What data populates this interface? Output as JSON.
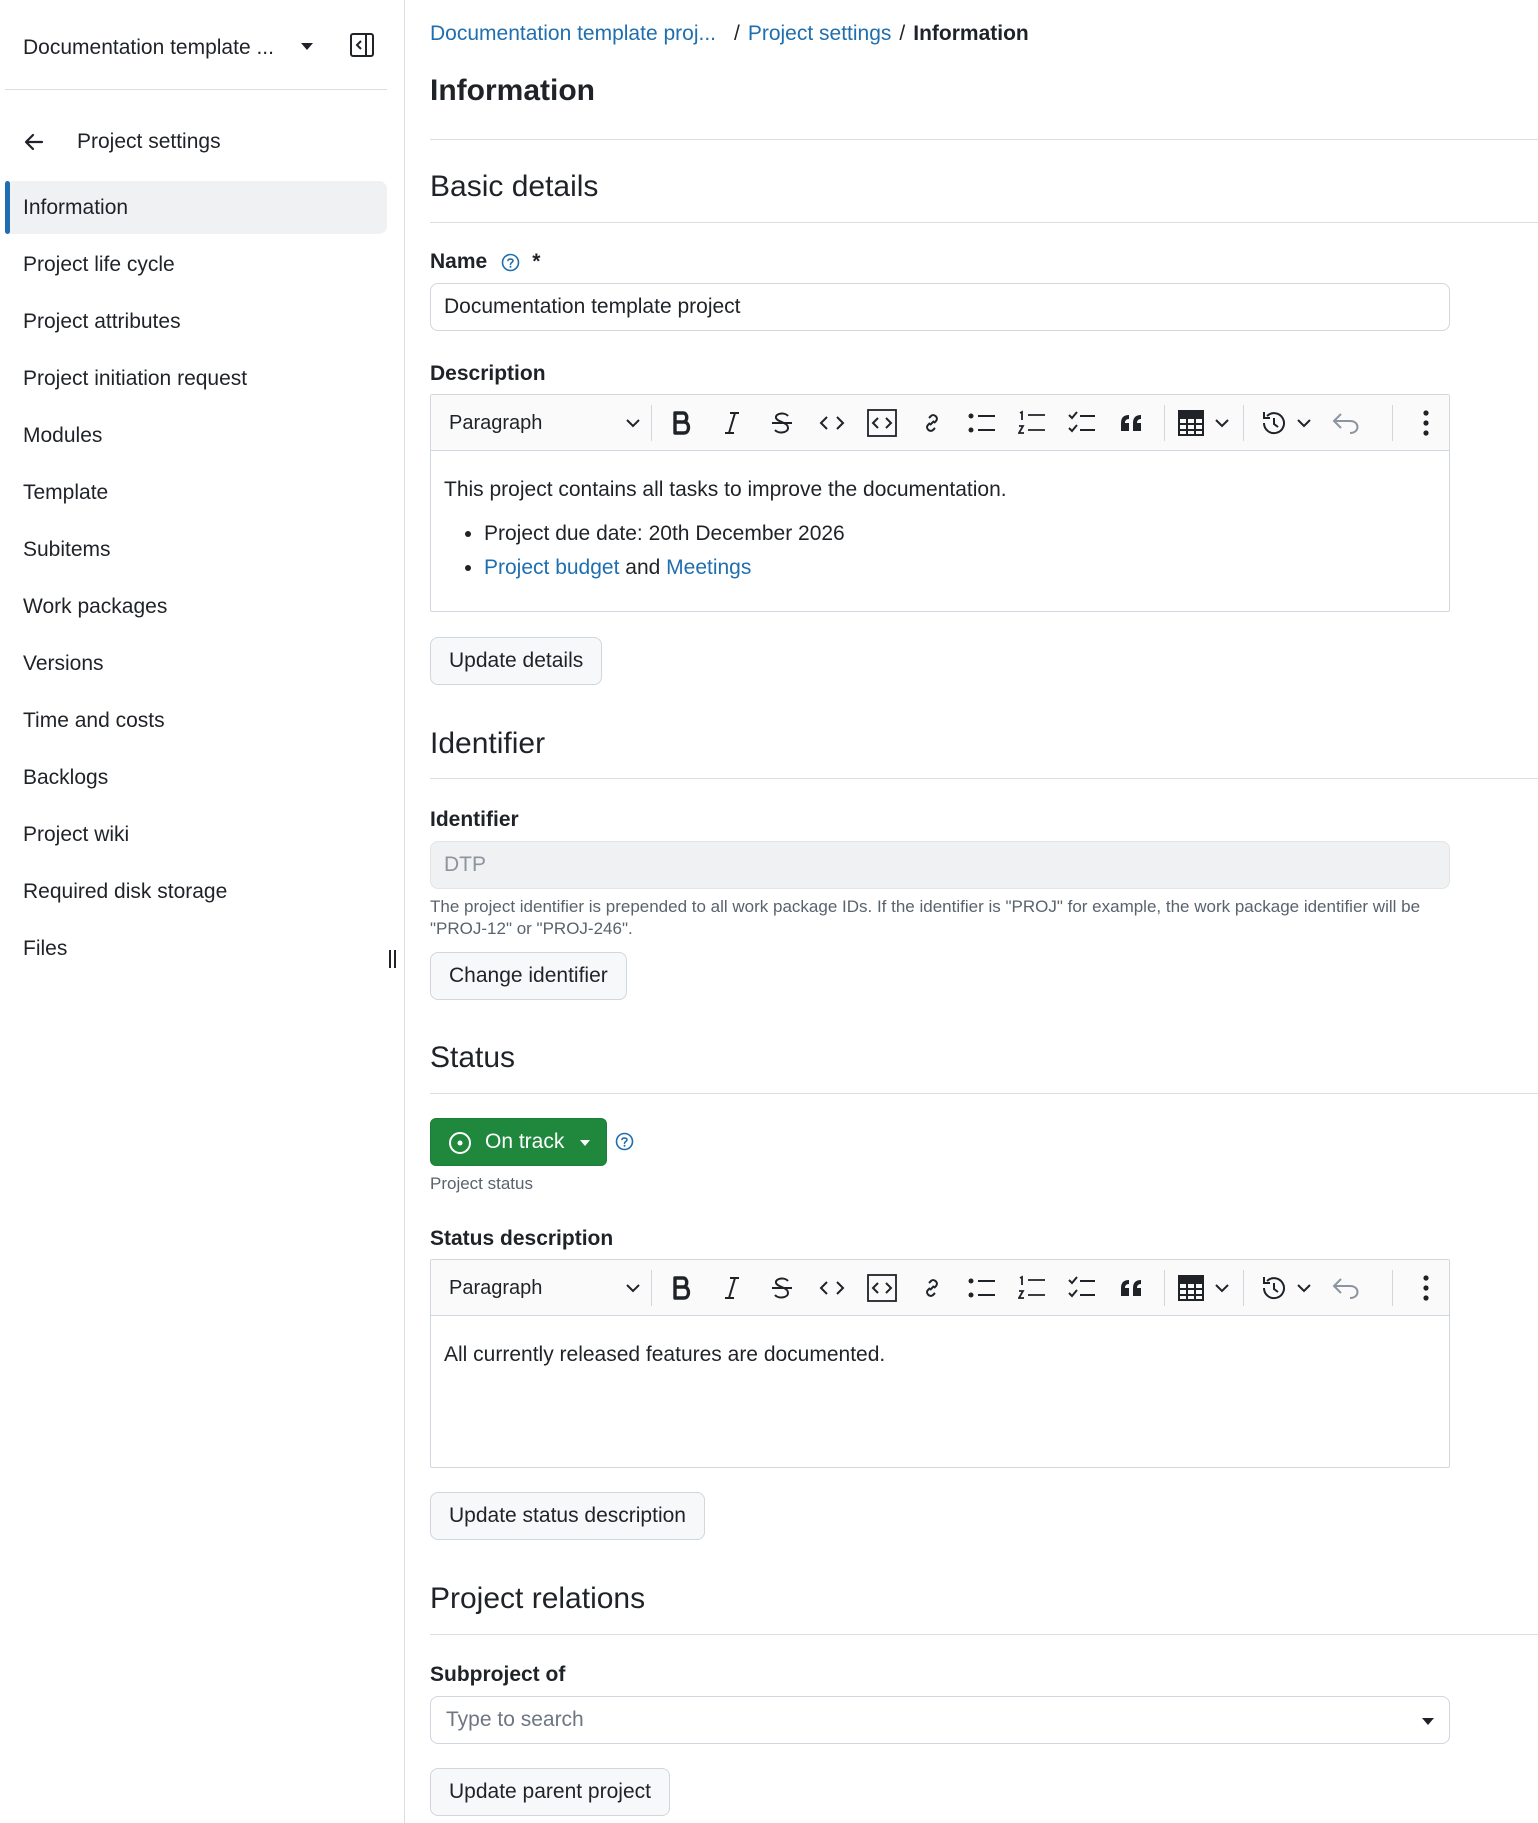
{
  "sidebar": {
    "project_name": "Documentation template ...",
    "back_label": "Project settings",
    "items": [
      {
        "label": "Information",
        "active": true
      },
      {
        "label": "Project life cycle"
      },
      {
        "label": "Project attributes"
      },
      {
        "label": "Project initiation request"
      },
      {
        "label": "Modules"
      },
      {
        "label": "Template"
      },
      {
        "label": "Subitems"
      },
      {
        "label": "Work packages"
      },
      {
        "label": "Versions"
      },
      {
        "label": "Time and costs"
      },
      {
        "label": "Backlogs"
      },
      {
        "label": "Project wiki"
      },
      {
        "label": "Required disk storage"
      },
      {
        "label": "Files"
      }
    ]
  },
  "breadcrumb": {
    "project": "Documentation template proj...",
    "sep1": "/",
    "settings": "Project settings",
    "sep2": "/",
    "current": "Information"
  },
  "page_title": "Information",
  "basic_details": {
    "title": "Basic details",
    "name_label": "Name",
    "required_mark": "*",
    "name_value": "Documentation template project",
    "description_label": "Description",
    "toolbar_paragraph": "Paragraph",
    "description_text": "This project contains all tasks to improve the documentation.",
    "bullet1": "Project due date: 20th December 2026",
    "bullet2_link1": "Project budget",
    "bullet2_and": " and ",
    "bullet2_link2": "Meetings",
    "update_button": "Update details"
  },
  "identifier": {
    "title": "Identifier",
    "label": "Identifier",
    "value": "DTP",
    "hint": "The project identifier is prepended to all work package IDs. If the identifier is \"PROJ\" for example, the work package identifier will be \"PROJ-12\" or \"PROJ-246\".",
    "change_button": "Change identifier"
  },
  "status": {
    "title": "Status",
    "status_value": "On track",
    "status_caption": "Project status",
    "description_label": "Status description",
    "toolbar_paragraph": "Paragraph",
    "description_text": "All currently released features are documented.",
    "update_button": "Update status description",
    "status_color": "#1f883d"
  },
  "relations": {
    "title": "Project relations",
    "subproject_label": "Subproject of",
    "search_placeholder": "Type to search",
    "update_button": "Update parent project"
  },
  "colors": {
    "link": "#1f6fb0",
    "accent": "#1f6fb0",
    "success": "#1f883d"
  },
  "toolbar_icons": [
    "bold-icon",
    "italic-icon",
    "strikethrough-icon",
    "code-icon",
    "code-block-icon",
    "link-icon",
    "bulleted-list-icon",
    "numbered-list-icon",
    "todo-list-icon",
    "blockquote-icon",
    "table-icon",
    "history-icon",
    "undo-icon",
    "more-icon"
  ]
}
